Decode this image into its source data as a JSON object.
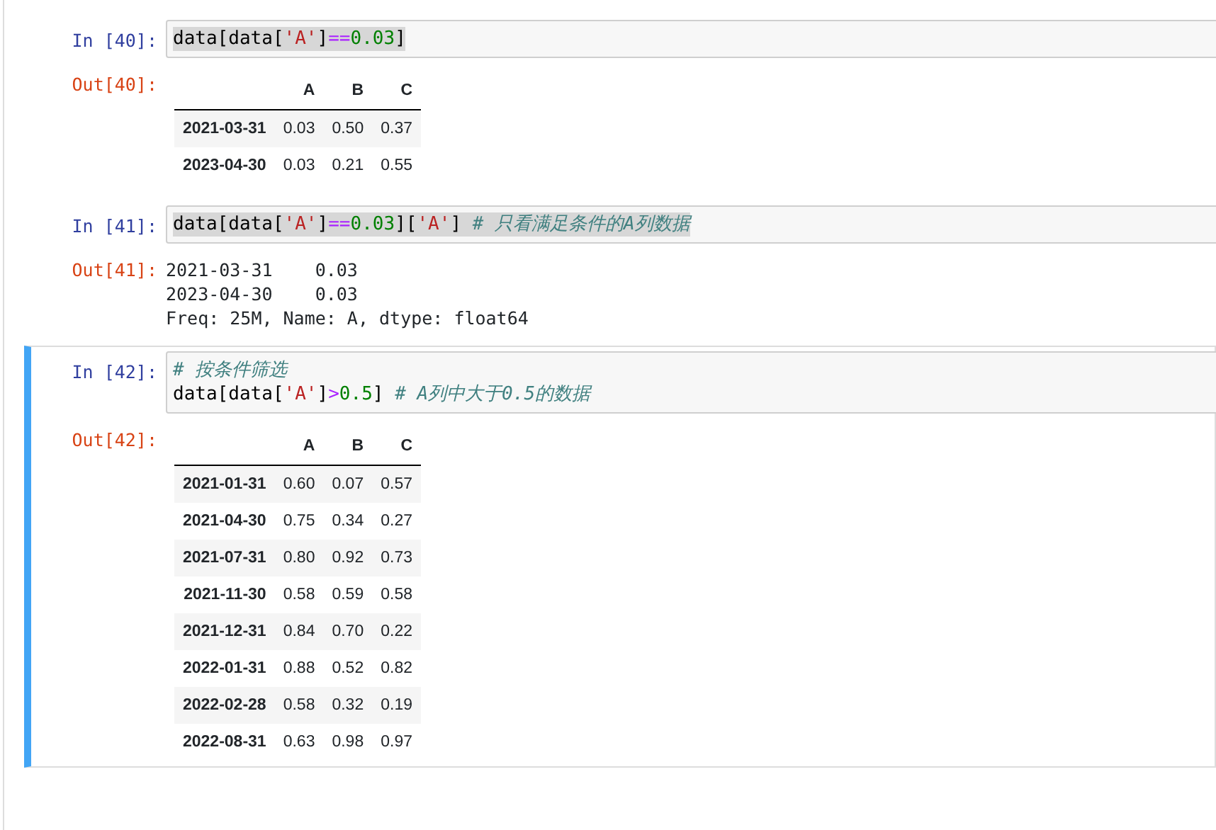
{
  "cells": [
    {
      "selected": false,
      "prompt_in": "In [40]:",
      "input": {
        "highlighted": true,
        "lines": [
          [
            {
              "kind": "plain",
              "text": "data[data["
            },
            {
              "kind": "string",
              "text": "'A'"
            },
            {
              "kind": "plain",
              "text": "]"
            },
            {
              "kind": "op",
              "text": "=="
            },
            {
              "kind": "number",
              "text": "0.03"
            },
            {
              "kind": "plain",
              "text": "]"
            }
          ]
        ]
      },
      "prompt_out": "Out[40]:",
      "output": {
        "kind": "table",
        "columns": [
          "A",
          "B",
          "C"
        ],
        "rows": [
          {
            "index": "2021-03-31",
            "values": [
              "0.03",
              "0.50",
              "0.37"
            ]
          },
          {
            "index": "2023-04-30",
            "values": [
              "0.03",
              "0.21",
              "0.55"
            ]
          }
        ]
      }
    },
    {
      "selected": false,
      "prompt_in": "In [41]:",
      "input": {
        "highlighted": true,
        "lines": [
          [
            {
              "kind": "plain",
              "text": "data[data["
            },
            {
              "kind": "string",
              "text": "'A'"
            },
            {
              "kind": "plain",
              "text": "]"
            },
            {
              "kind": "op",
              "text": "=="
            },
            {
              "kind": "number",
              "text": "0.03"
            },
            {
              "kind": "plain",
              "text": "]["
            },
            {
              "kind": "string",
              "text": "'A'"
            },
            {
              "kind": "plain",
              "text": "] "
            },
            {
              "kind": "comment",
              "text": "# 只看满足条件的A列数据"
            }
          ]
        ]
      },
      "prompt_out": "Out[41]:",
      "output": {
        "kind": "text",
        "lines": [
          "2021-03-31    0.03",
          "2023-04-30    0.03",
          "Freq: 25M, Name: A, dtype: float64"
        ]
      }
    },
    {
      "selected": true,
      "prompt_in": "In [42]:",
      "input": {
        "highlighted": false,
        "lines": [
          [
            {
              "kind": "comment",
              "text": "# 按条件筛选"
            }
          ],
          [
            {
              "kind": "plain",
              "text": "data[data["
            },
            {
              "kind": "string",
              "text": "'A'"
            },
            {
              "kind": "plain",
              "text": "]"
            },
            {
              "kind": "op",
              "text": ">"
            },
            {
              "kind": "number",
              "text": "0.5"
            },
            {
              "kind": "plain",
              "text": "] "
            },
            {
              "kind": "comment",
              "text": "# A列中大于0.5的数据"
            }
          ]
        ]
      },
      "prompt_out": "Out[42]:",
      "output": {
        "kind": "table",
        "columns": [
          "A",
          "B",
          "C"
        ],
        "rows": [
          {
            "index": "2021-01-31",
            "values": [
              "0.60",
              "0.07",
              "0.57"
            ]
          },
          {
            "index": "2021-04-30",
            "values": [
              "0.75",
              "0.34",
              "0.27"
            ]
          },
          {
            "index": "2021-07-31",
            "values": [
              "0.80",
              "0.92",
              "0.73"
            ]
          },
          {
            "index": "2021-11-30",
            "values": [
              "0.58",
              "0.59",
              "0.58"
            ]
          },
          {
            "index": "2021-12-31",
            "values": [
              "0.84",
              "0.70",
              "0.22"
            ]
          },
          {
            "index": "2022-01-31",
            "values": [
              "0.88",
              "0.52",
              "0.82"
            ]
          },
          {
            "index": "2022-02-28",
            "values": [
              "0.58",
              "0.32",
              "0.19"
            ]
          },
          {
            "index": "2022-08-31",
            "values": [
              "0.63",
              "0.98",
              "0.97"
            ]
          }
        ]
      }
    }
  ]
}
